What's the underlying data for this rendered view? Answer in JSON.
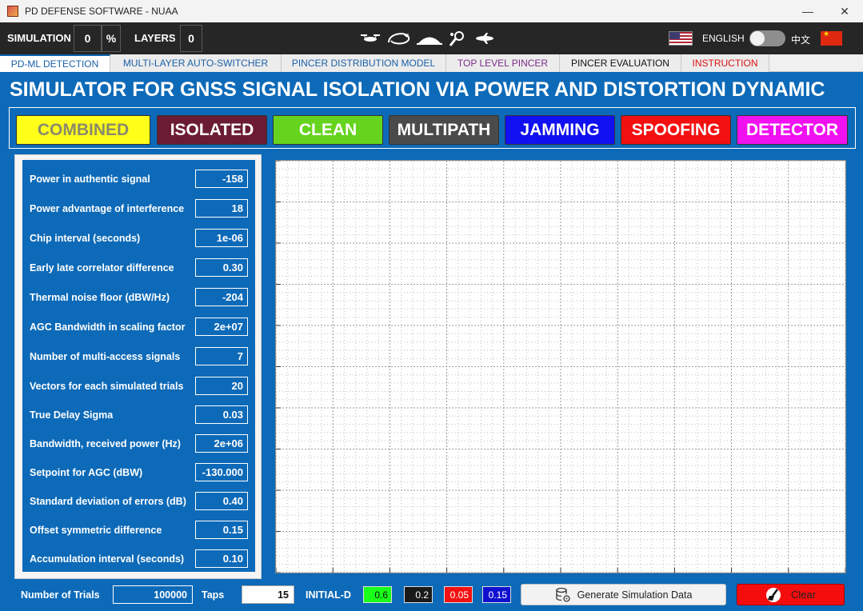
{
  "window": {
    "title": "PD DEFENSE SOFTWARE - NUAA",
    "minimize_glyph": "—",
    "maximize_glyph": "☐",
    "close_glyph": "✕"
  },
  "toolbar": {
    "simulation_label": "SIMULATION",
    "simulation_value": "0",
    "percent_sign": "%",
    "layers_label": "LAYERS",
    "layers_value": "0",
    "icons": [
      "drone-icon",
      "plane-loop-icon",
      "jet-icon",
      "satellite-pin-icon",
      "aircraft-icon"
    ],
    "language_label": "ENGLISH",
    "chinese_label": "中文"
  },
  "tabs": [
    {
      "label": "PD-ML DETECTION",
      "color": "#1a5fa8"
    },
    {
      "label": "MULTI-LAYER AUTO-SWITCHER",
      "color": "#1a5fa8"
    },
    {
      "label": "PINCER DISTRIBUTION MODEL",
      "color": "#1a5fa8"
    },
    {
      "label": "TOP LEVEL PINCER",
      "color": "#7b2b8a"
    },
    {
      "label": "PINCER EVALUATION",
      "color": "#111111"
    },
    {
      "label": "INSTRUCTION",
      "color": "#d11"
    }
  ],
  "heading": "SIMULATOR FOR GNSS SIGNAL ISOLATION VIA POWER AND DISTORTION DYNAMIC",
  "categories": [
    {
      "label": "COMBINED",
      "bg": "#ffff1a",
      "fg": "#8a8a6a"
    },
    {
      "label": "ISOLATED",
      "bg": "#6b1c33",
      "fg": "#ffffff"
    },
    {
      "label": "CLEAN",
      "bg": "#66d41f",
      "fg": "#ffffff"
    },
    {
      "label": "MULTIPATH",
      "bg": "#4a4a4a",
      "fg": "#ffffff"
    },
    {
      "label": "JAMMING",
      "bg": "#1010f0",
      "fg": "#ffffff"
    },
    {
      "label": "SPOOFING",
      "bg": "#f21010",
      "fg": "#ffffff"
    },
    {
      "label": "DETECTOR",
      "bg": "#f010f0",
      "fg": "#ffffff"
    }
  ],
  "params": [
    {
      "label": "Power in authentic signal",
      "value": "-158"
    },
    {
      "label": "Power advantage of interference",
      "value": "18"
    },
    {
      "label": "Chip interval (seconds)",
      "value": "1e-06"
    },
    {
      "label": "Early late correlator difference",
      "value": "0.30"
    },
    {
      "label": "Thermal noise floor (dBW/Hz)",
      "value": "-204"
    },
    {
      "label": "AGC Bandwidth in scaling factor",
      "value": "2e+07"
    },
    {
      "label": "Number of multi-access signals",
      "value": "7"
    },
    {
      "label": "Vectors for each simulated trials",
      "value": "20"
    },
    {
      "label": "True Delay Sigma",
      "value": "0.03"
    },
    {
      "label": "Bandwidth, received power (Hz)",
      "value": "2e+06"
    },
    {
      "label": "Setpoint for AGC (dBW)",
      "value": "-130.000"
    },
    {
      "label": "Standard deviation of errors (dB)",
      "value": "0.40"
    },
    {
      "label": "Offset symmetric difference",
      "value": "0.15"
    },
    {
      "label": "Accumulation interval (seconds)",
      "value": "0.10"
    }
  ],
  "bottom": {
    "trials_label": "Number of Trials",
    "trials_value": "100000",
    "taps_label": "Taps",
    "taps_value": "15",
    "initial_label": "INITIAL-D",
    "chips": [
      {
        "value": "0.6",
        "bg": "#1aff1a",
        "fg": "#111111"
      },
      {
        "value": "0.2",
        "bg": "#1a1a1a",
        "fg": "#ffffff"
      },
      {
        "value": "0.05",
        "bg": "#f21010",
        "fg": "#ffffff"
      },
      {
        "value": "0.15",
        "bg": "#1010d0",
        "fg": "#ffffff"
      }
    ],
    "generate_label": "Generate Simulation Data",
    "clear_label": "Clear"
  }
}
